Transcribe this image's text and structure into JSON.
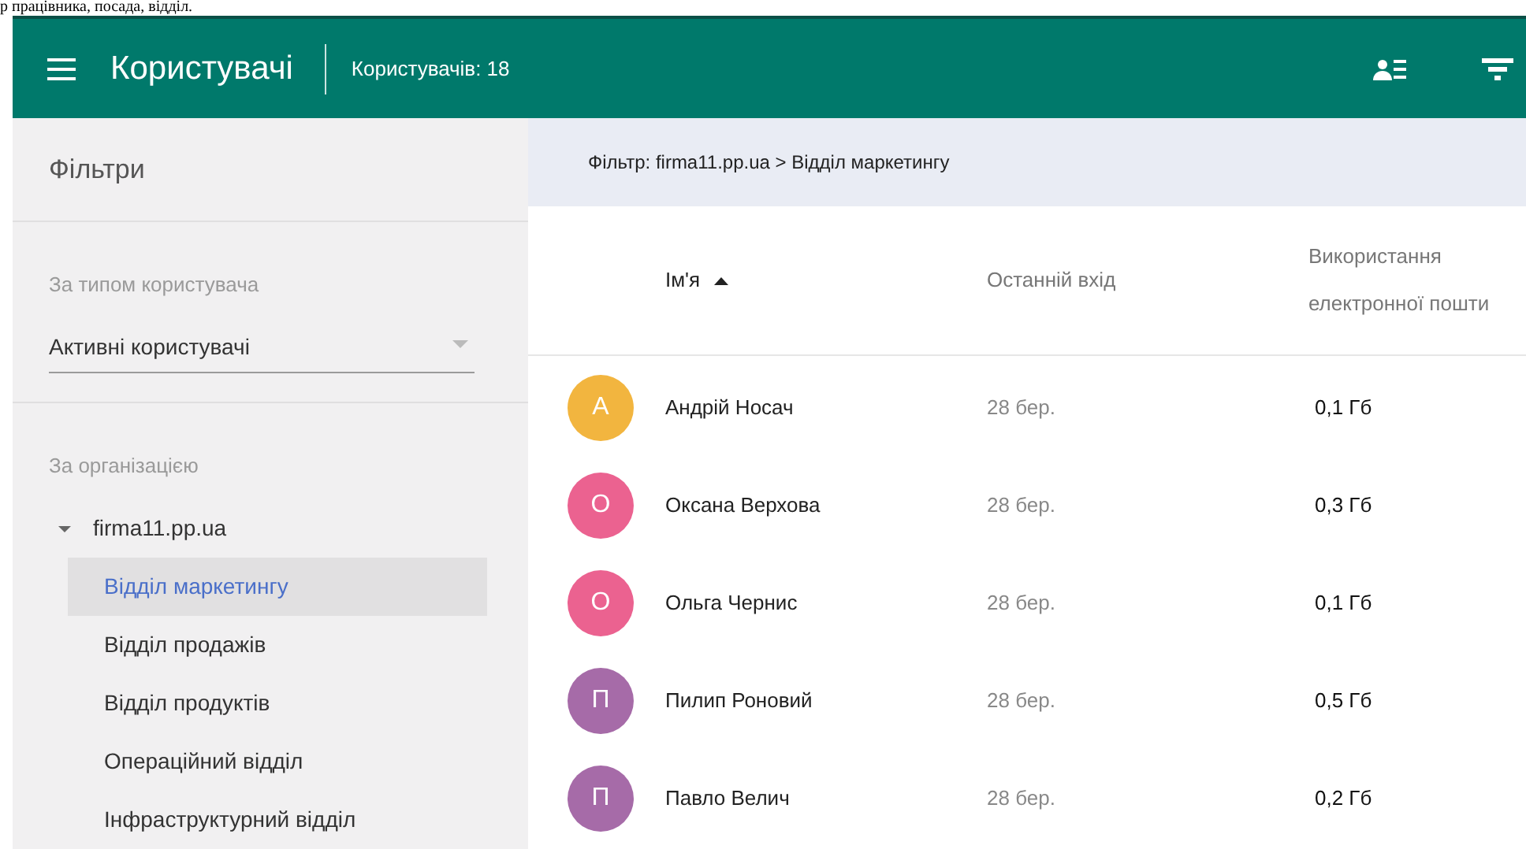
{
  "page_caption": "р працівника, посада, відділ.",
  "header": {
    "title": "Користувачі",
    "count": "Користувачів: 18"
  },
  "sidebar": {
    "title": "Фільтри",
    "user_type": {
      "label": "За типом користувача",
      "value": "Активні користувачі"
    },
    "organization": {
      "label": "За організацією",
      "tree": [
        {
          "label": "firma11.pp.ua",
          "expanded": true,
          "selected": false,
          "children": [
            {
              "label": "Відділ маркетингу",
              "selected": true
            },
            {
              "label": "Відділ продажів",
              "selected": false
            },
            {
              "label": "Відділ продуктів",
              "selected": false
            },
            {
              "label": "Операційний відділ",
              "selected": false
            },
            {
              "label": "Інфраструктурний відділ",
              "selected": false
            }
          ]
        }
      ]
    }
  },
  "breadcrumb": "Фільтр: firma11.pp.ua > Відділ маркетингу",
  "table": {
    "columns": [
      {
        "label": "Ім'я",
        "sorted": true,
        "descending": false
      },
      {
        "label": "Останній вхід"
      },
      {
        "label": "Використання електронної пошти"
      }
    ],
    "rows": [
      {
        "initial": "А",
        "color": "#f2b53f",
        "name": "Андрій Носач",
        "last_login": "28 бер.",
        "email_usage": "0,1 Гб"
      },
      {
        "initial": "О",
        "color": "#eb6290",
        "name": "Оксана Верхова",
        "last_login": "28 бер.",
        "email_usage": "0,3 Гб"
      },
      {
        "initial": "О",
        "color": "#eb6290",
        "name": "Ольга Чернис",
        "last_login": "28 бер.",
        "email_usage": "0,1 Гб"
      },
      {
        "initial": "П",
        "color": "#a66ba8",
        "name": "Пилип Роновий",
        "last_login": "28 бер.",
        "email_usage": "0,5 Гб"
      },
      {
        "initial": "П",
        "color": "#a66ba8",
        "name": "Павло Велич",
        "last_login": "28 бер.",
        "email_usage": "0,2 Гб"
      }
    ]
  }
}
